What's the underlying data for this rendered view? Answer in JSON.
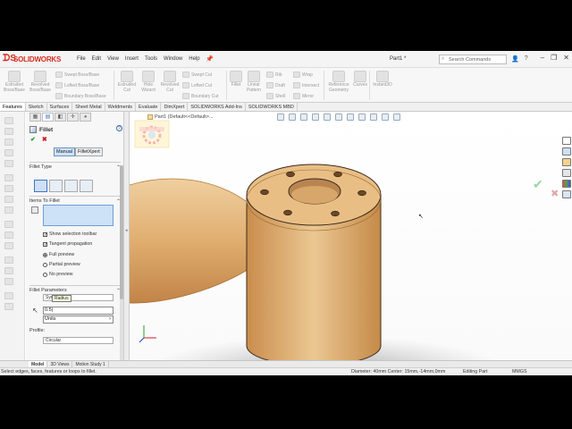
{
  "app": {
    "logo_text": "SOLIDWORKS",
    "document_title": "Part1 *"
  },
  "menu": [
    "File",
    "Edit",
    "View",
    "Insert",
    "Tools",
    "Window",
    "Help"
  ],
  "search": {
    "placeholder": "Search Commands"
  },
  "command_manager": {
    "large": [
      "Extruded Boss/Base",
      "Revolved Boss/Base",
      "Extruded Cut",
      "Hole Wizard",
      "Revolved Cut",
      "Fillet",
      "Linear Pattern",
      "Reference Geometry",
      "Curves",
      "Instant3D"
    ],
    "small": [
      "Swept Boss/Base",
      "Lofted Boss/Base",
      "Boundary Boss/Base",
      "Swept Cut",
      "Lofted Cut",
      "Boundary Cut",
      "Rib",
      "Draft",
      "Shell",
      "Wrap",
      "Intersect",
      "Mirror"
    ]
  },
  "tabs": [
    "Features",
    "Sketch",
    "Surfaces",
    "Sheet Metal",
    "Weldments",
    "Evaluate",
    "DimXpert",
    "SOLIDWORKS Add-Ins",
    "SOLIDWORKS MBD"
  ],
  "property_manager": {
    "title": "Fillet",
    "modes": [
      "Manual",
      "FilletXpert"
    ],
    "sections": {
      "fillet_type": "Fillet Type",
      "items_to_fillet": "Items To Fillet",
      "fillet_parameters": "Fillet Parameters"
    },
    "options": {
      "show_selection_toolbar": "Show selection toolbar",
      "tangent_propagation": "Tangent propagation",
      "full_preview": "Full preview",
      "partial_preview": "Partial preview",
      "no_preview": "No preview"
    },
    "parameters": {
      "symmetric": "Sym",
      "tooltip": "Radius",
      "radius_value": "0.5|",
      "units_value": "Units",
      "profile_label": "Profile:",
      "profile_value": "Circular"
    }
  },
  "viewport": {
    "breadcrumb": "Part1 (Default<<Default>..."
  },
  "bottom_tabs": [
    "Model",
    "3D Views",
    "Motion Study 1"
  ],
  "status": {
    "message": "Select edges, faces, features or loops to fillet.",
    "measurement": "Diameter: 40mm  Center: 15mm,-14mm,0mm",
    "mode": "Editing Part",
    "units": "MMGS"
  }
}
